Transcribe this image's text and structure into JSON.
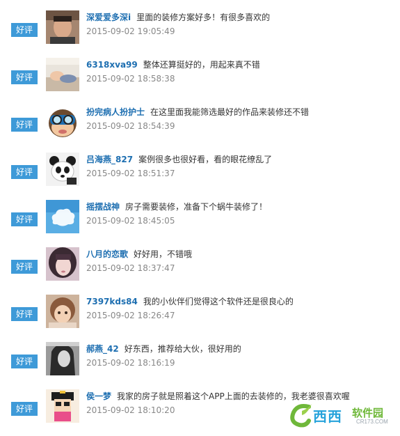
{
  "reviews": [
    {
      "badge": "好评",
      "username": "深爱爱多深i",
      "comment": "里面的装修方案好多！有很多喜欢的",
      "time": "2015-09-02 19:05:49",
      "avatar_icon": "man-portrait-icon"
    },
    {
      "badge": "好评",
      "username": "6318xva99",
      "comment": "整体还算挺好的，用起来真不错",
      "time": "2015-09-02 18:58:38",
      "avatar_icon": "sleeping-baby-icon"
    },
    {
      "badge": "好评",
      "username": "扮完病人扮护士",
      "comment": "在这里面我能筛选最好的作品来装修还不错",
      "time": "2015-09-02 18:54:39",
      "avatar_icon": "cartoon-goggles-icon"
    },
    {
      "badge": "好评",
      "username": "吕海燕_827",
      "comment": "案例很多也很好看，看的眼花缭乱了",
      "time": "2015-09-02 18:51:37",
      "avatar_icon": "panda-icon"
    },
    {
      "badge": "好评",
      "username": "摇摆战神",
      "comment": "房子需要装修，准备下个蜗牛装修了！",
      "time": "2015-09-02 18:45:05",
      "avatar_icon": "cloud-icon"
    },
    {
      "badge": "好评",
      "username": "八月的恋歌",
      "comment": "好好用，不错哦",
      "time": "2015-09-02 18:37:47",
      "avatar_icon": "girl-portrait-icon"
    },
    {
      "badge": "好评",
      "username": "7397kds84",
      "comment": "我的小伙伴们觉得这个软件还是很良心的",
      "time": "2015-09-02 18:26:47",
      "avatar_icon": "child-portrait-icon"
    },
    {
      "badge": "好评",
      "username": "郝燕_42",
      "comment": "好东西，推荐给大伙，很好用的",
      "time": "2015-09-02 18:16:19",
      "avatar_icon": "bw-woman-portrait-icon"
    },
    {
      "badge": "好评",
      "username": "侯一梦",
      "comment": "我家的房子就是照着这个APP上面的去装修的，我老婆很喜欢喔",
      "time": "2015-09-02 18:10:20",
      "avatar_icon": "cartoon-girl-icon"
    }
  ],
  "watermark": {
    "brand": "西西",
    "suffix": "软件园",
    "url": "CR173.COM"
  },
  "colors": {
    "badge": "#3e9ad8",
    "username": "#1e6fb1",
    "time": "#888888"
  }
}
